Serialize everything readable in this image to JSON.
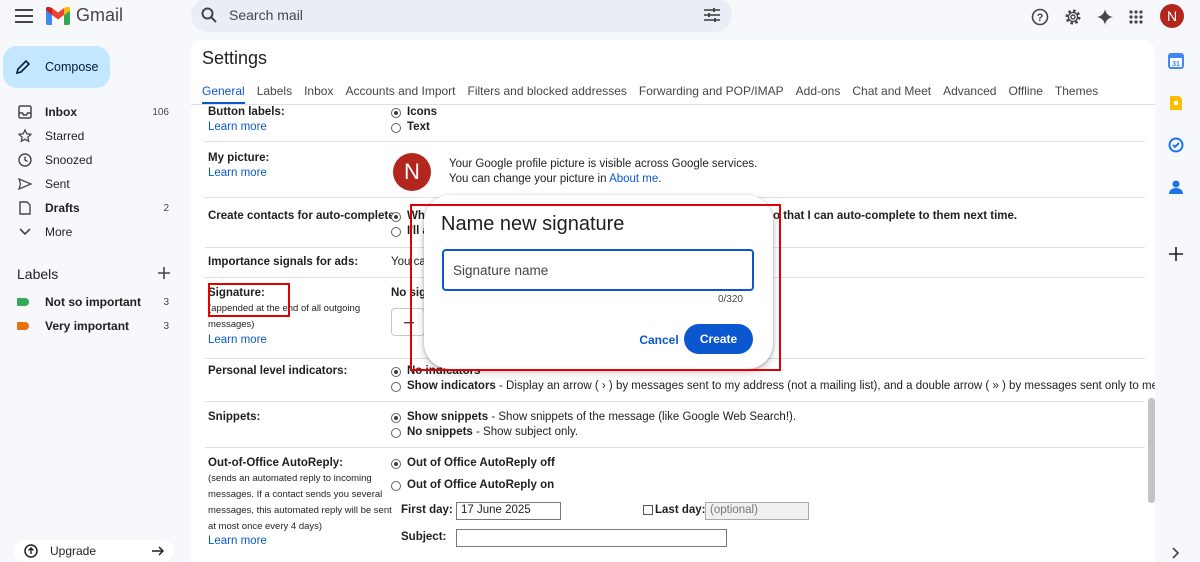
{
  "app": {
    "name": "Gmail"
  },
  "search": {
    "placeholder": "Search mail"
  },
  "nav": {
    "compose_label": "Compose",
    "items": [
      {
        "label": "Inbox",
        "count": "106",
        "bold": true,
        "icon": "inbox-icon"
      },
      {
        "label": "Starred",
        "count": "",
        "icon": "star-icon"
      },
      {
        "label": "Snoozed",
        "count": "",
        "icon": "clock-icon"
      },
      {
        "label": "Sent",
        "count": "",
        "icon": "send-icon"
      },
      {
        "label": "Drafts",
        "count": "2",
        "bold": true,
        "icon": "draft-icon"
      },
      {
        "label": "More",
        "count": "",
        "icon": "chevron-down-icon"
      }
    ],
    "labels_heading": "Labels",
    "labels": [
      {
        "label": "Not so important",
        "count": "3",
        "color": "#34a853"
      },
      {
        "label": "Very important",
        "count": "3",
        "color": "#e8710a"
      }
    ],
    "upgrade_label": "Upgrade"
  },
  "user": {
    "initial": "N",
    "avatar_color": "#b3261e"
  },
  "settings": {
    "title": "Settings",
    "tabs": [
      "General",
      "Labels",
      "Inbox",
      "Accounts and Import",
      "Filters and blocked addresses",
      "Forwarding and POP/IMAP",
      "Add-ons",
      "Chat and Meet",
      "Advanced",
      "Offline",
      "Themes"
    ],
    "learn_more": "Learn more",
    "button_labels": {
      "label": "Button labels:",
      "opt1": "Icons",
      "opt2": "Text"
    },
    "my_picture": {
      "label": "My picture:",
      "line1": "Your Google profile picture is visible across Google services.",
      "line2_prefix": "You can change your picture in",
      "line2_link": "About me",
      "line2_suffix": "."
    },
    "contacts": {
      "label": "Create contacts for auto-complete:",
      "opt1_visible_start": "Wh",
      "opt1_visible_end": "o that I can auto-complete to them next time.",
      "opt2_visible_start": "I'll a"
    },
    "importance": {
      "label": "Importance signals for ads:",
      "text_visible_start": "You ca"
    },
    "signature": {
      "label": "Signature:",
      "sub1": "(appended at the end of all outgoing",
      "sub2": "messages)",
      "text_visible_start": "No sig"
    },
    "personal": {
      "label": "Personal level indicators:",
      "opt1": "No indicators",
      "opt2_bold": "Show indicators",
      "opt2_rest": " - Display an arrow ( › ) by messages sent to my address (not a mailing list), and a double arrow ( » ) by messages sent only to me."
    },
    "snippets": {
      "label": "Snippets:",
      "opt1_bold": "Show snippets",
      "opt1_rest": " - Show snippets of the message (like Google Web Search!).",
      "opt2_bold": "No snippets",
      "opt2_rest": " - Show subject only."
    },
    "ooo": {
      "label": "Out-of-Office AutoReply:",
      "sub": [
        "(sends an automated reply to incoming",
        "messages. If a contact sends you several",
        "messages, this automated reply will be sent",
        "at most once every 4 days)"
      ],
      "opt1": "Out of Office AutoReply off",
      "opt2": "Out of Office AutoReply on",
      "first_day_label": "First day:",
      "first_day_value": "17 June 2025",
      "last_day_label": "Last day:",
      "last_day_placeholder": "(optional)",
      "subject_label": "Subject:"
    }
  },
  "dialog": {
    "title": "Name new signature",
    "placeholder": "Signature name",
    "char_count": "0/320",
    "cancel": "Cancel",
    "create": "Create"
  },
  "annotations": {
    "color": "#e30000"
  }
}
